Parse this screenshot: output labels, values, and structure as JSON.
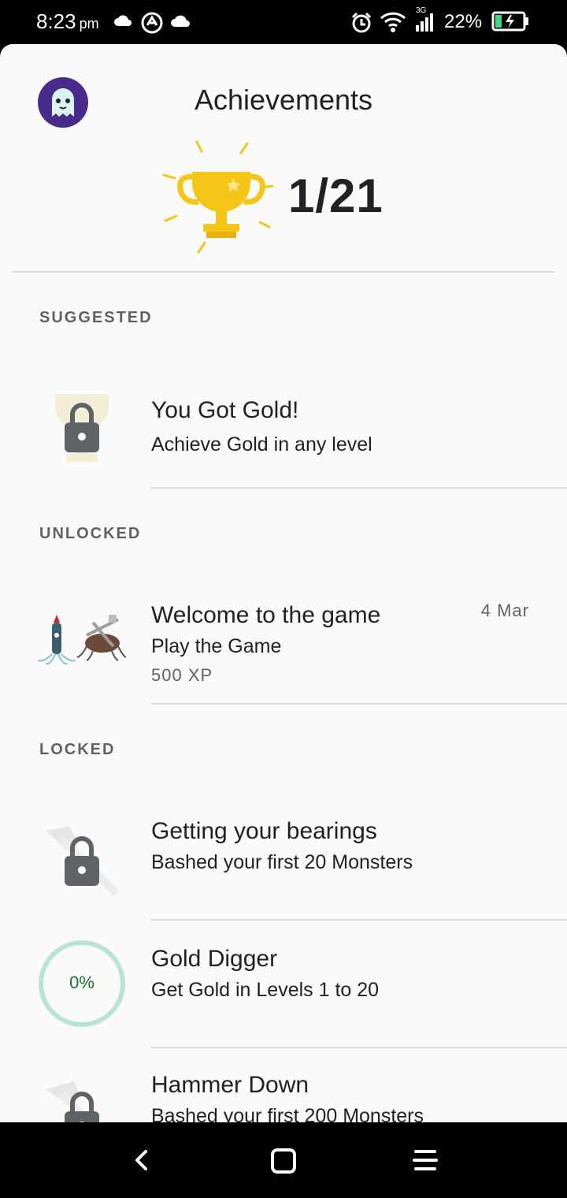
{
  "status": {
    "time": "8:23",
    "ampm": "pm",
    "network": "3G",
    "battery": "22%"
  },
  "header": {
    "title": "Achievements",
    "progress": "1/21"
  },
  "sections": {
    "suggested": "SUGGESTED",
    "unlocked": "UNLOCKED",
    "locked": "LOCKED"
  },
  "achievements": {
    "gold": {
      "title": "You Got Gold!",
      "desc": "Achieve Gold in any level"
    },
    "welcome": {
      "title": "Welcome to the game",
      "desc": "Play the Game",
      "xp": "500 XP",
      "date": "4 Mar"
    },
    "bearings": {
      "title": "Getting your bearings",
      "desc": "Bashed your first 20 Monsters"
    },
    "digger": {
      "title": "Gold Digger",
      "desc": "Get Gold in Levels 1 to 20",
      "progress_label": "0%",
      "progress_value": 0
    },
    "hammer": {
      "title": "Hammer Down",
      "desc": "Bashed your first 200 Monsters"
    }
  },
  "colors": {
    "accent_gold": "#f5c518",
    "progress_ring": "#b7e4d6",
    "progress_text": "#137333",
    "lock": "#5f6368"
  },
  "icons": [
    "cloud-icon",
    "at-sign-icon",
    "alarm-icon",
    "wifi-icon",
    "signal-icon",
    "battery-icon",
    "trophy-icon",
    "lock-icon",
    "back-icon",
    "home-icon",
    "menu-icon"
  ]
}
